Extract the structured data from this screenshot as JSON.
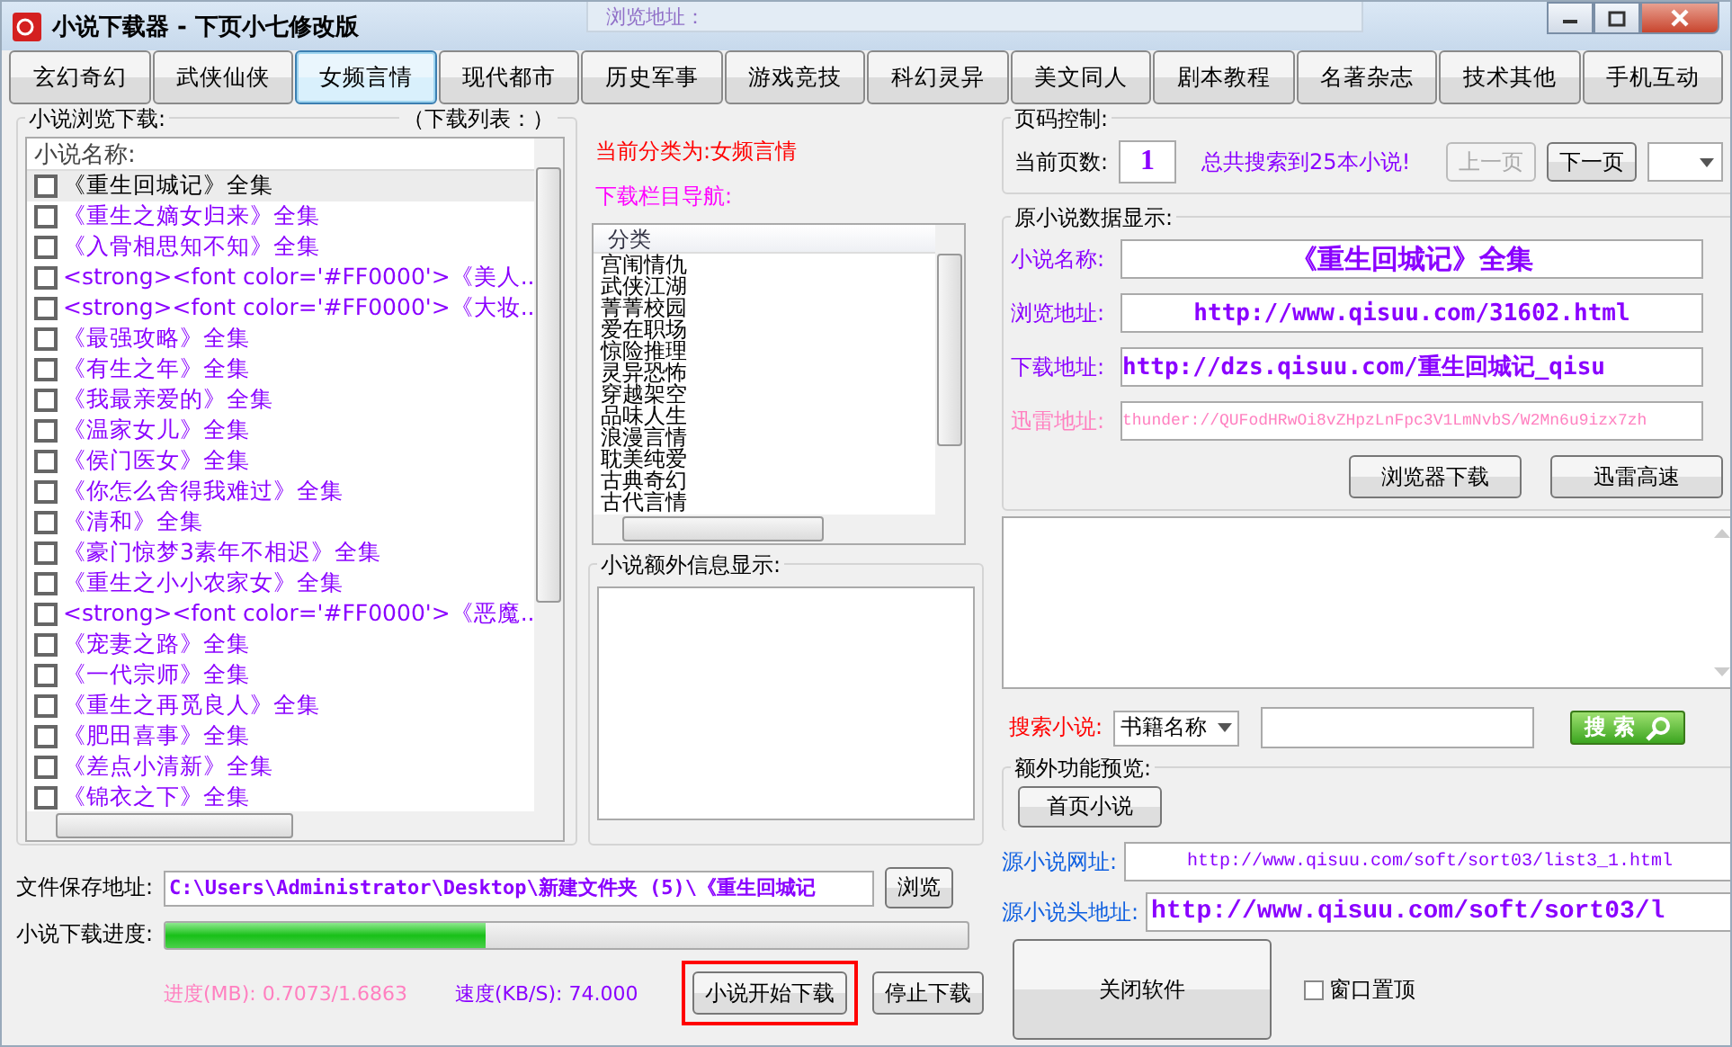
{
  "background_window": {
    "field_label": "浏览地址："
  },
  "window": {
    "title": "小说下载器 - 下页小七修改版"
  },
  "tabs": [
    {
      "label": "玄幻奇幻",
      "selected": false
    },
    {
      "label": "武侠仙侠",
      "selected": false
    },
    {
      "label": "女频言情",
      "selected": true
    },
    {
      "label": "现代都市",
      "selected": false
    },
    {
      "label": "历史军事",
      "selected": false
    },
    {
      "label": "游戏竞技",
      "selected": false
    },
    {
      "label": "科幻灵异",
      "selected": false
    },
    {
      "label": "美文同人",
      "selected": false
    },
    {
      "label": "剧本教程",
      "selected": false
    },
    {
      "label": "名著杂志",
      "selected": false
    },
    {
      "label": "技术其他",
      "selected": false
    },
    {
      "label": "手机互动",
      "selected": false
    }
  ],
  "browse_panel": {
    "title": "小说浏览下载:",
    "subtitle": "（下载列表：）",
    "column": "小说名称:",
    "rows": [
      {
        "title": "《重生回城记》全集",
        "checked": false,
        "selected": true
      },
      {
        "title": "《重生之嫡女归来》全集",
        "checked": false,
        "selected": false
      },
      {
        "title": "《入骨相思知不知》全集",
        "checked": false,
        "selected": false
      },
      {
        "title": "<strong><font color='#FF0000'>《美人..",
        "checked": false,
        "selected": false
      },
      {
        "title": "<strong><font color='#FF0000'>《大妆..",
        "checked": false,
        "selected": false
      },
      {
        "title": "《最强攻略》全集",
        "checked": false,
        "selected": false
      },
      {
        "title": "《有生之年》全集",
        "checked": false,
        "selected": false
      },
      {
        "title": "《我最亲爱的》全集",
        "checked": false,
        "selected": false
      },
      {
        "title": "《温家女儿》全集",
        "checked": false,
        "selected": false
      },
      {
        "title": "《侯门医女》全集",
        "checked": false,
        "selected": false
      },
      {
        "title": "《你怎么舍得我难过》全集",
        "checked": false,
        "selected": false
      },
      {
        "title": "《清和》全集",
        "checked": false,
        "selected": false
      },
      {
        "title": "《豪门惊梦3素年不相迟》全集",
        "checked": false,
        "selected": false
      },
      {
        "title": "《重生之小小农家女》全集",
        "checked": false,
        "selected": false
      },
      {
        "title": "<strong><font color='#FF0000'>《恶魔..",
        "checked": false,
        "selected": false
      },
      {
        "title": "《宠妻之路》全集",
        "checked": false,
        "selected": false
      },
      {
        "title": "《一代宗师》全集",
        "checked": false,
        "selected": false
      },
      {
        "title": "《重生之再觅良人》全集",
        "checked": false,
        "selected": false
      },
      {
        "title": "《肥田喜事》全集",
        "checked": false,
        "selected": false
      },
      {
        "title": "《差点小清新》全集",
        "checked": false,
        "selected": false
      },
      {
        "title": "《锦衣之下》全集",
        "checked": false,
        "selected": false
      }
    ]
  },
  "category_panel": {
    "current": "当前分类为:女频言情",
    "nav_label": "下载栏目导航:",
    "column": "分类",
    "items": [
      "宫闱情仇",
      "武侠江湖",
      "菁菁校园",
      "爱在职场",
      "惊险推理",
      "灵异恐怖",
      "穿越架空",
      "品味人生",
      "浪漫言情",
      "耽美纯爱",
      "古典奇幻",
      "古代言情"
    ]
  },
  "extra_info": {
    "title": "小说额外信息显示:"
  },
  "page_control": {
    "title": "页码控制:",
    "page_label": "当前页数:",
    "page": "1",
    "summary": "总共搜索到25本小说!",
    "buttons": [
      {
        "label": "上一页",
        "disabled": true
      },
      {
        "label": "下一页",
        "disabled": false
      }
    ]
  },
  "novel_data": {
    "title": "原小说数据显示:",
    "fields": [
      {
        "label": "小说名称:",
        "value": "《重生回城记》全集",
        "kind": "title"
      },
      {
        "label": "浏览地址:",
        "value": "http://www.qisuu.com/31602.html",
        "kind": "url"
      },
      {
        "label": "下载地址:",
        "value": "http://dzs.qisuu.com/重生回城记_qisu",
        "kind": "download"
      },
      {
        "label": "迅雷地址:",
        "value": "thunder://QUFodHRwOi8vZHpzLnFpc3V1LmNvbS/W2Mn6u9izx7zh",
        "kind": "thunder"
      }
    ],
    "buttons": [
      "浏览器下载",
      "迅雷高速"
    ]
  },
  "search": {
    "label": "搜索小说:",
    "mode": "书籍名称",
    "button": "搜 索"
  },
  "extra_features": {
    "title": "额外功能预览:",
    "button": "首页小说"
  },
  "sources": [
    {
      "label": "源小说网址:",
      "value": "http://www.qisuu.com/soft/sort03/list3_1.html",
      "kind": "small"
    },
    {
      "label": "源小说头地址:",
      "value": "http://www.qisuu.com/soft/sort03/l",
      "kind": "large"
    }
  ],
  "close_button": "关闭软件",
  "topmost": {
    "label": "窗口置顶",
    "checked": false
  },
  "save": {
    "label": "文件保存地址:",
    "value": "C:\\Users\\Administrator\\Desktop\\新建文件夹 (5)\\《重生回城记",
    "button": "浏览"
  },
  "progress": {
    "label": "小说下载进度:",
    "level": 0.4,
    "mb": "进度(MB): 0.7073/1.6863",
    "speed": "速度(KB/S): 74.000"
  },
  "download_buttons": [
    {
      "label": "小说开始下载",
      "highlighted": true
    },
    {
      "label": "停止下载",
      "highlighted": false
    }
  ]
}
